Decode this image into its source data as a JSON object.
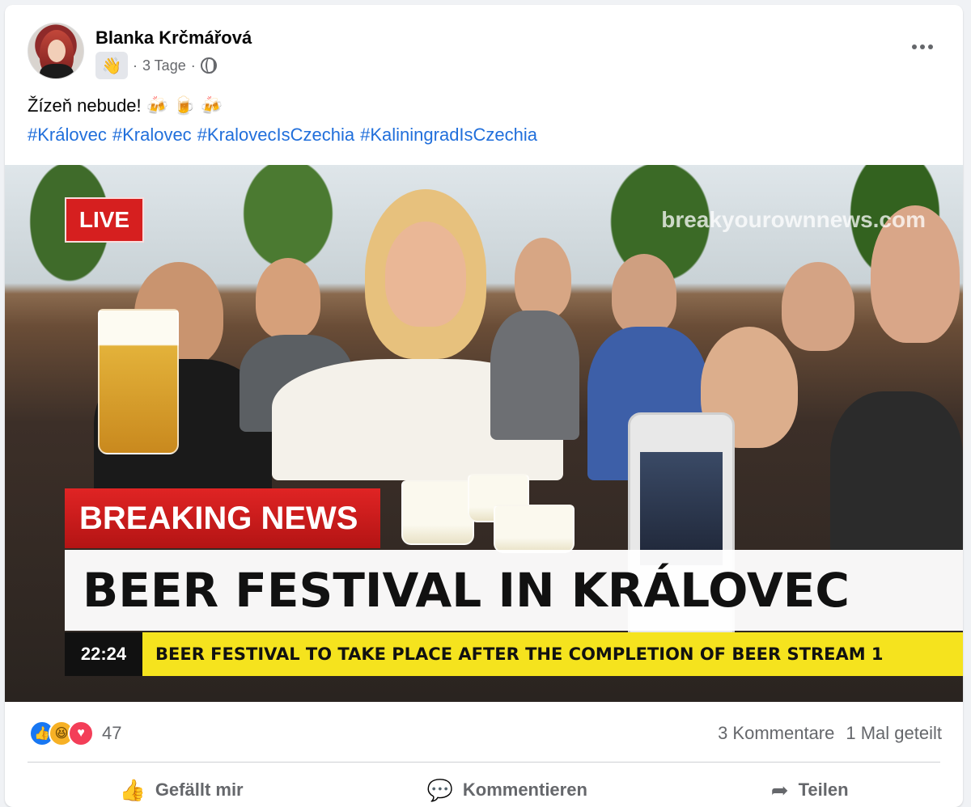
{
  "post": {
    "author": "Blanka Krčmářová",
    "badge_icon": "wave-hand-icon",
    "time": "3 Tage",
    "separator": "·",
    "privacy_icon": "globe-icon",
    "text": "Žízeň nebude! 🍻 🍺 🍻",
    "hashtags": [
      "#Královec",
      "#Kralovec",
      "#KralovecIsCzechia",
      "#KaliningradIsCzechia"
    ]
  },
  "image": {
    "live_label": "LIVE",
    "watermark": "breakyourownnews.com",
    "breaking_label": "BREAKING NEWS",
    "headline": "BEER FESTIVAL IN KRÁLOVEC",
    "ticker_time": "22:24",
    "ticker_text": "BEER FESTIVAL TO TAKE PLACE AFTER THE COMPLETION OF BEER STREAM 1"
  },
  "engagement": {
    "reaction_count": "47",
    "comments": "3 Kommentare",
    "shares": "1 Mal geteilt"
  },
  "actions": {
    "like": "Gefällt mir",
    "comment": "Kommentieren",
    "share": "Teilen"
  },
  "colors": {
    "link": "#216fdb",
    "breaking_red": "#d61f1f",
    "ticker_yellow": "#f5e31e"
  }
}
